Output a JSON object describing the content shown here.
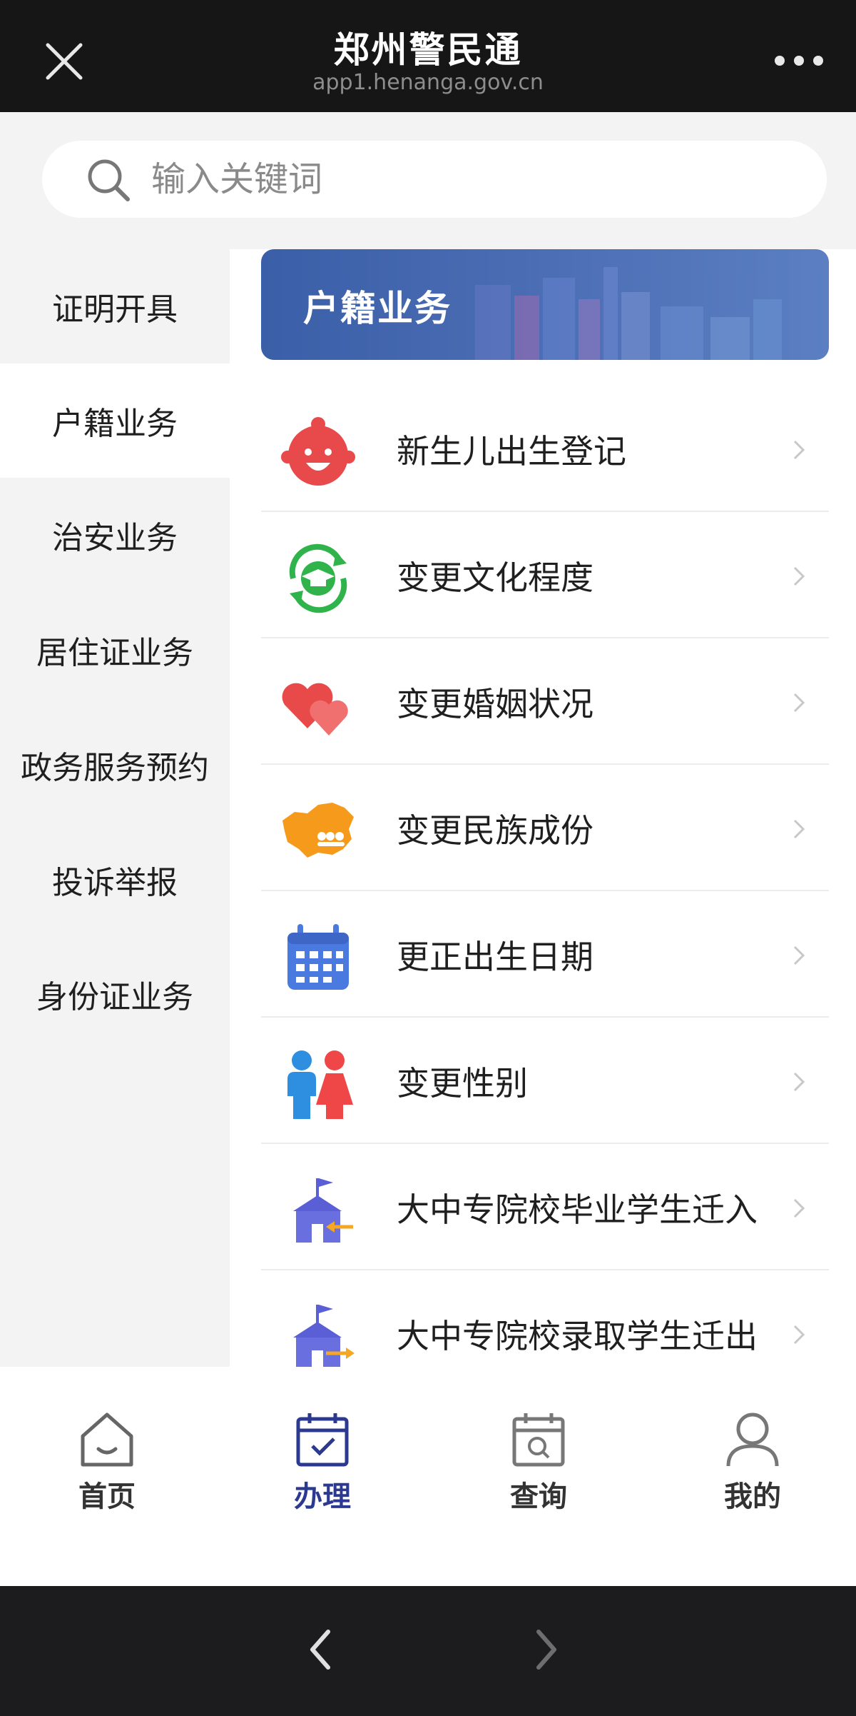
{
  "header": {
    "title": "郑州警民通",
    "url": "app1.henanga.gov.cn"
  },
  "search": {
    "placeholder": "输入关键词"
  },
  "sidebar": {
    "items": [
      {
        "label": "证明开具"
      },
      {
        "label": "户籍业务"
      },
      {
        "label": "治安业务"
      },
      {
        "label": "居住证业务"
      },
      {
        "label": "政务服务预约"
      },
      {
        "label": "投诉举报"
      },
      {
        "label": "身份证业务"
      }
    ],
    "active_index": 1
  },
  "content": {
    "banner_title": "户籍业务",
    "items": [
      {
        "label": "新生儿出生登记",
        "icon": "baby-face-icon"
      },
      {
        "label": "变更文化程度",
        "icon": "graduation-cap-icon"
      },
      {
        "label": "变更婚姻状况",
        "icon": "hearts-icon"
      },
      {
        "label": "变更民族成份",
        "icon": "china-map-icon"
      },
      {
        "label": "更正出生日期",
        "icon": "calendar-icon"
      },
      {
        "label": "变更性别",
        "icon": "gender-icon"
      },
      {
        "label": "大中专院校毕业学生迁入",
        "icon": "school-in-icon"
      },
      {
        "label": "大中专院校录取学生迁出",
        "icon": "school-out-icon"
      }
    ]
  },
  "tabbar": {
    "tabs": [
      {
        "label": "首页",
        "icon": "home-icon"
      },
      {
        "label": "办理",
        "icon": "calendar-check-icon"
      },
      {
        "label": "查询",
        "icon": "calendar-search-icon"
      },
      {
        "label": "我的",
        "icon": "user-icon"
      }
    ],
    "active_index": 1
  },
  "colors": {
    "accent": "#2b3990",
    "banner": "#4a6cb3",
    "topbar": "#161616"
  }
}
